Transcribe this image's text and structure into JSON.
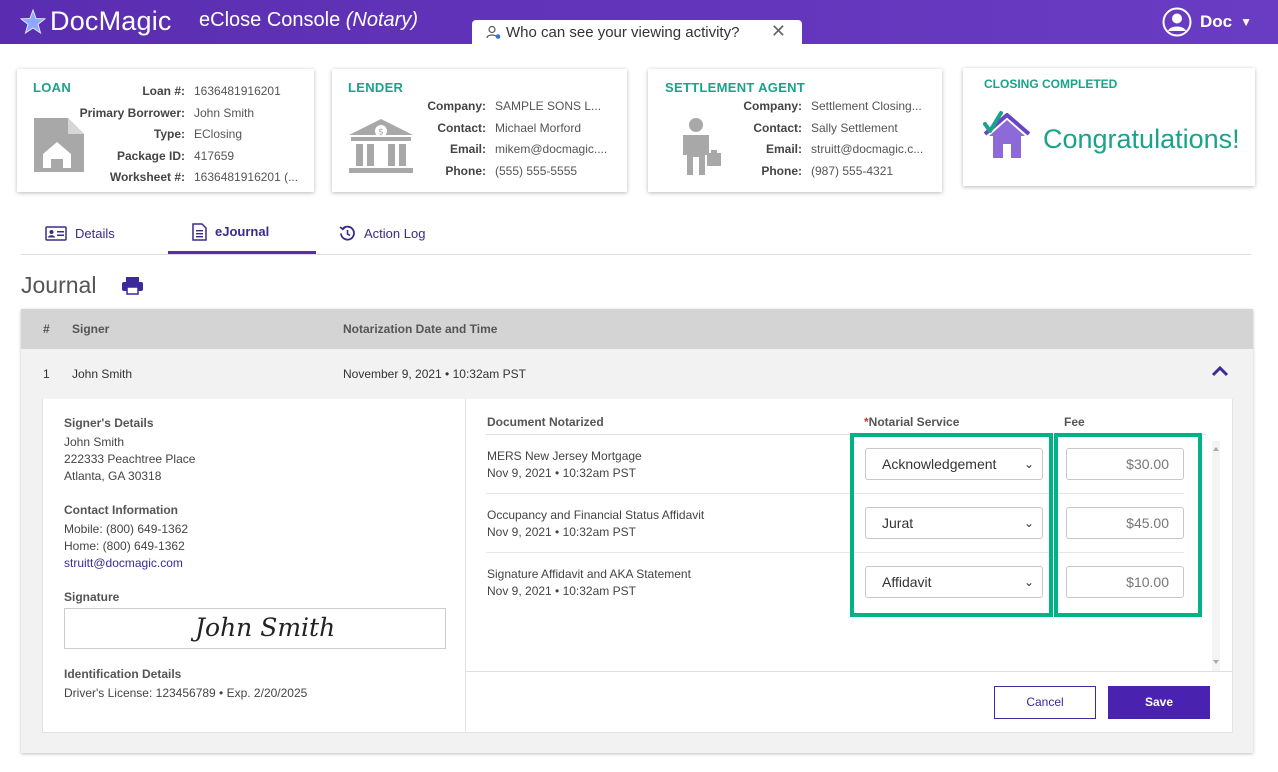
{
  "app": {
    "brand": "DocMagic",
    "console_title": "eClose Console",
    "console_role": "(Notary)",
    "user": "Doc"
  },
  "privacy_tab": {
    "label": "Who can see your viewing activity?"
  },
  "loan": {
    "title": "LOAN",
    "rows": [
      {
        "k": "Loan #:",
        "v": "1636481916201"
      },
      {
        "k": "Primary Borrower:",
        "v": "John Smith"
      },
      {
        "k": "Type:",
        "v": "EClosing"
      },
      {
        "k": "Package ID:",
        "v": "417659"
      },
      {
        "k": "Worksheet #:",
        "v": "1636481916201 (..."
      }
    ]
  },
  "lender": {
    "title": "LENDER",
    "rows": [
      {
        "k": "Company:",
        "v": "SAMPLE SONS L..."
      },
      {
        "k": "Contact:",
        "v": "Michael Morford"
      },
      {
        "k": "Email:",
        "v": "mikem@docmagic...."
      },
      {
        "k": "Phone:",
        "v": "(555) 555-5555"
      }
    ]
  },
  "agent": {
    "title": "SETTLEMENT AGENT",
    "rows": [
      {
        "k": "Company:",
        "v": "Settlement Closing..."
      },
      {
        "k": "Contact:",
        "v": "Sally Settlement"
      },
      {
        "k": "Email:",
        "v": "struitt@docmagic.c..."
      },
      {
        "k": "Phone:",
        "v": "(987) 555-4321"
      }
    ]
  },
  "closing": {
    "title": "CLOSING COMPLETED",
    "message": "Congratulations!"
  },
  "tabs": [
    {
      "label": "Details"
    },
    {
      "label": "eJournal"
    },
    {
      "label": "Action Log"
    }
  ],
  "journal": {
    "title": "Journal",
    "columns": {
      "num": "#",
      "signer": "Signer",
      "date": "Notarization Date and Time"
    },
    "row": {
      "num": "1",
      "signer": "John Smith",
      "date": "November 9, 2021 • 10:32am PST"
    }
  },
  "signer_details": {
    "heading": "Signer's Details",
    "name": "John Smith",
    "address1": "222333 Peachtree Place",
    "address2": "Atlanta, GA 30318",
    "contact_heading": "Contact Information",
    "mobile": "Mobile: (800) 649-1362",
    "home": "Home: (800) 649-1362",
    "email": "struitt@docmagic.com",
    "signature_heading": "Signature",
    "signature": "John Smith",
    "id_heading": "Identification Details",
    "id_value": "Driver's License: 123456789 • Exp. 2/20/2025"
  },
  "documents": {
    "col_doc": "Document Notarized",
    "col_service_req": "*",
    "col_service": "Notarial Service",
    "col_fee": "Fee",
    "items": [
      {
        "name": "MERS New Jersey Mortgage",
        "date": "Nov 9, 2021 • 10:32am PST",
        "service": "Acknowledgement",
        "fee": "$30.00"
      },
      {
        "name": "Occupancy and Financial Status Affidavit",
        "date": "Nov 9, 2021 • 10:32am PST",
        "service": "Jurat",
        "fee": "$45.00"
      },
      {
        "name": "Signature Affidavit and AKA Statement",
        "date": "Nov 9, 2021 • 10:32am PST",
        "service": "Affidavit",
        "fee": "$10.00"
      }
    ]
  },
  "buttons": {
    "cancel": "Cancel",
    "save": "Save"
  },
  "colors": {
    "brand": "#5a2db0",
    "accent": "#1aa38a",
    "highlight": "#00b386"
  }
}
